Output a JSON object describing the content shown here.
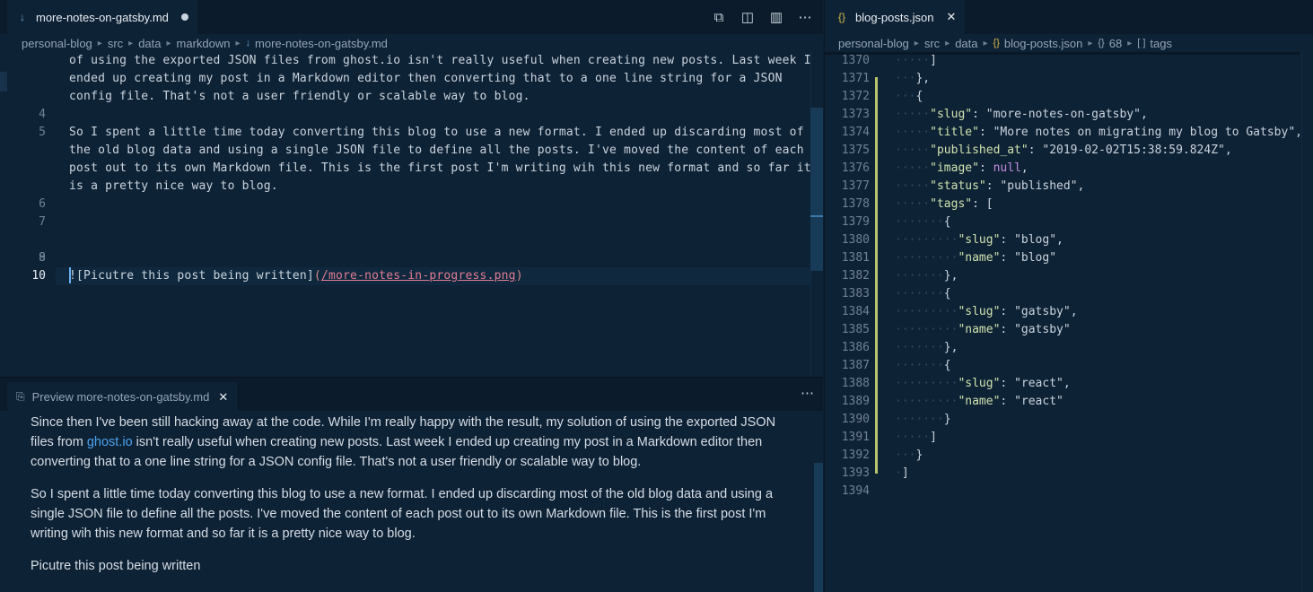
{
  "left_tab": {
    "icon": "markdown-file-icon",
    "label": "more-notes-on-gatsby.md"
  },
  "left_breadcrumb": [
    "personal-blog",
    "src",
    "data",
    "markdown",
    "more-notes-on-gatsby.md"
  ],
  "editor_lines": [
    {
      "num": "",
      "text": "of using the exported JSON files from ghost.io isn't really useful when creating new posts. Last week I"
    },
    {
      "num": "",
      "text": "ended up creating my post in a Markdown editor then converting that to a one line string for a JSON"
    },
    {
      "num": "",
      "text": "config file. That's not a user friendly or scalable way to blog."
    },
    {
      "num": "4",
      "text": ""
    },
    {
      "num": "5",
      "text": "So I spent a little time today converting this blog to use a new format. I ended up discarding most of"
    },
    {
      "num": "",
      "text": "the old blog data and using a single JSON file to define all the posts. I've moved the content of each"
    },
    {
      "num": "",
      "text": "post out to its own Markdown file. This is the first post I'm writing wih this new format and so far it"
    },
    {
      "num": "",
      "text": "is a pretty nice way to blog."
    },
    {
      "num": "6",
      "text": ""
    },
    {
      "num": "7",
      "text": ""
    },
    {
      "num": "8",
      "text": ""
    },
    {
      "num": "9",
      "text": ""
    },
    {
      "num": "10",
      "text": ""
    }
  ],
  "image_link": {
    "alt": "![Picutre this post being written]",
    "open": "(",
    "url": "/more-notes-in-progress.png",
    "close": ")"
  },
  "preview_tab": {
    "label": "Preview more-notes-on-gatsby.md"
  },
  "preview": {
    "p1_before": "Since then I've been still hacking away at the code. While I'm really happy with the result, my solution of using the exported JSON files from ",
    "p1_link": "ghost.io",
    "p1_after": " isn't really useful when creating new posts. Last week I ended up creating my post in a Markdown editor then converting that to a one line string for a JSON config file. That's not a user friendly or scalable way to blog.",
    "p2": "So I spent a little time today converting this blog to use a new format. I ended up discarding most of the old blog data and using a single JSON file to define all the posts. I've moved the content of each post out to its own Markdown file. This is the first post I'm writing wih this new format and so far it is a pretty nice way to blog.",
    "p3": "Picutre this post being written"
  },
  "right_tab": {
    "icon": "{}",
    "label": "blog-posts.json"
  },
  "right_breadcrumb": {
    "items": [
      "personal-blog",
      "src",
      "data"
    ],
    "file": "blog-posts.json",
    "obj": "68",
    "arr": "tags"
  },
  "json_lines": [
    {
      "num": "1370",
      "indent": 3,
      "parts": [
        [
          "p",
          "]"
        ]
      ]
    },
    {
      "num": "1371",
      "indent": 2,
      "parts": [
        [
          "p",
          "},"
        ]
      ]
    },
    {
      "num": "1372",
      "indent": 2,
      "parts": [
        [
          "p",
          "{"
        ]
      ]
    },
    {
      "num": "1373",
      "indent": 3,
      "parts": [
        [
          "k",
          "\"slug\""
        ],
        [
          "p",
          ": "
        ],
        [
          "s",
          "\"more-notes-on-gatsby\""
        ],
        [
          "p",
          ","
        ]
      ]
    },
    {
      "num": "1374",
      "indent": 3,
      "parts": [
        [
          "k",
          "\"title\""
        ],
        [
          "p",
          ": "
        ],
        [
          "s",
          "\"More notes on migrating my blog to Gatsby\""
        ],
        [
          "p",
          ","
        ]
      ]
    },
    {
      "num": "1375",
      "indent": 3,
      "parts": [
        [
          "k",
          "\"published_at\""
        ],
        [
          "p",
          ": "
        ],
        [
          "s",
          "\"2019-02-02T15:38:59.824Z\""
        ],
        [
          "p",
          ","
        ]
      ]
    },
    {
      "num": "1376",
      "indent": 3,
      "parts": [
        [
          "k",
          "\"image\""
        ],
        [
          "p",
          ": "
        ],
        [
          "n",
          "null"
        ],
        [
          "p",
          ","
        ]
      ]
    },
    {
      "num": "1377",
      "indent": 3,
      "parts": [
        [
          "k",
          "\"status\""
        ],
        [
          "p",
          ": "
        ],
        [
          "s",
          "\"published\""
        ],
        [
          "p",
          ","
        ]
      ]
    },
    {
      "num": "1378",
      "indent": 3,
      "parts": [
        [
          "k",
          "\"tags\""
        ],
        [
          "p",
          ": ["
        ]
      ]
    },
    {
      "num": "1379",
      "indent": 4,
      "parts": [
        [
          "p",
          "{"
        ]
      ]
    },
    {
      "num": "1380",
      "indent": 5,
      "parts": [
        [
          "k",
          "\"slug\""
        ],
        [
          "p",
          ": "
        ],
        [
          "s",
          "\"blog\""
        ],
        [
          "p",
          ","
        ]
      ]
    },
    {
      "num": "1381",
      "indent": 5,
      "parts": [
        [
          "k",
          "\"name\""
        ],
        [
          "p",
          ": "
        ],
        [
          "s",
          "\"blog\""
        ]
      ]
    },
    {
      "num": "1382",
      "indent": 4,
      "parts": [
        [
          "p",
          "},"
        ]
      ]
    },
    {
      "num": "1383",
      "indent": 4,
      "parts": [
        [
          "p",
          "{"
        ]
      ]
    },
    {
      "num": "1384",
      "indent": 5,
      "parts": [
        [
          "k",
          "\"slug\""
        ],
        [
          "p",
          ": "
        ],
        [
          "s",
          "\"gatsby\""
        ],
        [
          "p",
          ","
        ]
      ]
    },
    {
      "num": "1385",
      "indent": 5,
      "parts": [
        [
          "k",
          "\"name\""
        ],
        [
          "p",
          ": "
        ],
        [
          "s",
          "\"gatsby\""
        ]
      ]
    },
    {
      "num": "1386",
      "indent": 4,
      "parts": [
        [
          "p",
          "},"
        ]
      ]
    },
    {
      "num": "1387",
      "indent": 4,
      "parts": [
        [
          "p",
          "{"
        ]
      ]
    },
    {
      "num": "1388",
      "indent": 5,
      "parts": [
        [
          "k",
          "\"slug\""
        ],
        [
          "p",
          ": "
        ],
        [
          "s",
          "\"react\""
        ],
        [
          "p",
          ","
        ]
      ]
    },
    {
      "num": "1389",
      "indent": 5,
      "parts": [
        [
          "k",
          "\"name\""
        ],
        [
          "p",
          ": "
        ],
        [
          "s",
          "\"react\""
        ]
      ]
    },
    {
      "num": "1390",
      "indent": 4,
      "parts": [
        [
          "p",
          "}"
        ]
      ]
    },
    {
      "num": "1391",
      "indent": 3,
      "parts": [
        [
          "p",
          "]"
        ]
      ]
    },
    {
      "num": "1392",
      "indent": 2,
      "parts": [
        [
          "p",
          "}"
        ]
      ]
    },
    {
      "num": "1393",
      "indent": 1,
      "parts": [
        [
          "p",
          "]"
        ]
      ]
    },
    {
      "num": "1394",
      "indent": 0,
      "parts": []
    }
  ],
  "colors": {
    "background": "#0e2235",
    "json_key": "#cfe3b0",
    "null": "#c38be0",
    "link": "#4aa3f0",
    "modified_gutter": "#b7c46a"
  }
}
